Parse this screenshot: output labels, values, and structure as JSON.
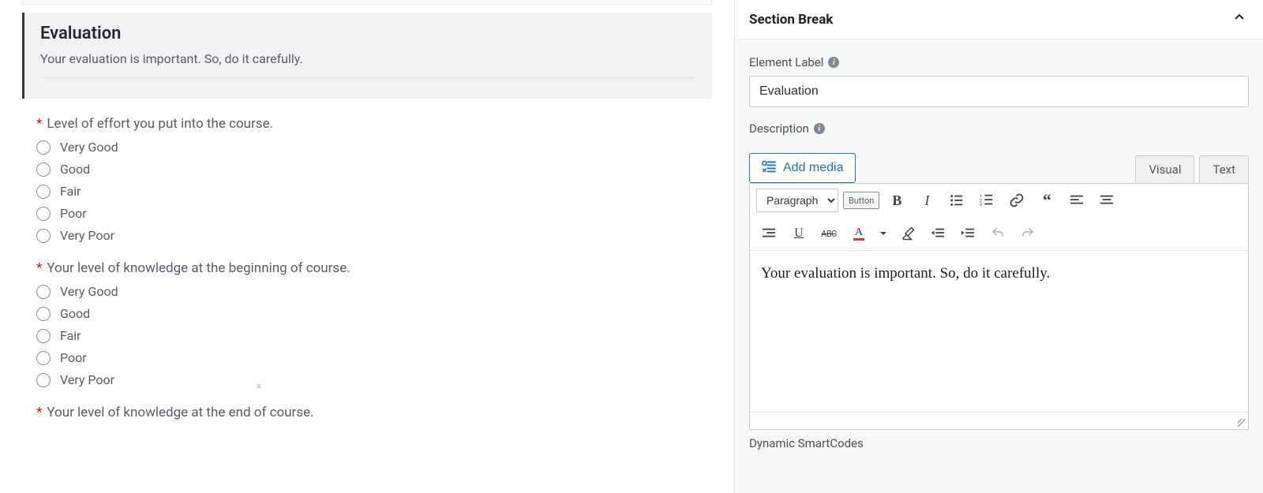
{
  "section": {
    "title": "Evaluation",
    "description": "Your evaluation is important. So, do it carefully."
  },
  "questions": [
    {
      "label": "Level of effort you put into the course.",
      "required": true,
      "options": [
        "Very Good",
        "Good",
        "Fair",
        "Poor",
        "Very Poor"
      ]
    },
    {
      "label": "Your level of knowledge at the beginning of course.",
      "required": true,
      "options": [
        "Very Good",
        "Good",
        "Fair",
        "Poor",
        "Very Poor"
      ]
    },
    {
      "label": "Your level of knowledge at the end of course.",
      "required": true,
      "options": []
    }
  ],
  "panel": {
    "title": "Section Break",
    "element_label_caption": "Element Label",
    "element_label_value": "Evaluation",
    "description_caption": "Description",
    "add_media_label": "Add media",
    "tabs": {
      "visual": "Visual",
      "text": "Text"
    },
    "format_select": "Paragraph",
    "button_pill": "Button",
    "editor_content": "Your evaluation is important. So, do it carefully.",
    "smartcodes_label": "Dynamic SmartCodes"
  }
}
